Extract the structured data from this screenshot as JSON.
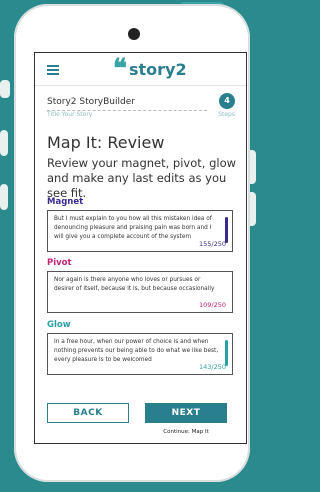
{
  "app": {
    "logo_text": "story2",
    "storybuilder_title": "Story2 StoryBuilder",
    "title_placeholder": "Title Your Story",
    "step_number": "4",
    "steps_label": "Steps"
  },
  "page": {
    "heading": "Map It: Review",
    "instructions": "Review your magnet, pivot, glow and make any last edits as you see fit."
  },
  "sections": [
    {
      "label": "Magnet",
      "text": "But I must explain to you how all this mistaken idea of denouncing pleasure and praising pain was born and I will give you a complete account of the system",
      "count": "155/250",
      "color": "#3a2a8f"
    },
    {
      "label": "Pivot",
      "text": "Nor again is there anyone who loves or pursues or desirer of itself, because it is, but because occasionally",
      "count": "109/250",
      "color": "#c2247a"
    },
    {
      "label": "Glow",
      "text": "In a free hour, when our power of choice is and when nothing prevents our being able to do what we like best, every pleasure is to be welcomed",
      "count": "143/250",
      "color": "#2a9fa6"
    }
  ],
  "buttons": {
    "back": "BACK",
    "next": "NEXT",
    "continue": "Continue: Map It"
  },
  "colors": {
    "brand": "#2a7f8f",
    "background": "#2a8a8d"
  },
  "icons": {
    "menu": "hamburger-icon",
    "logo_mark": "quote-mark-icon"
  }
}
